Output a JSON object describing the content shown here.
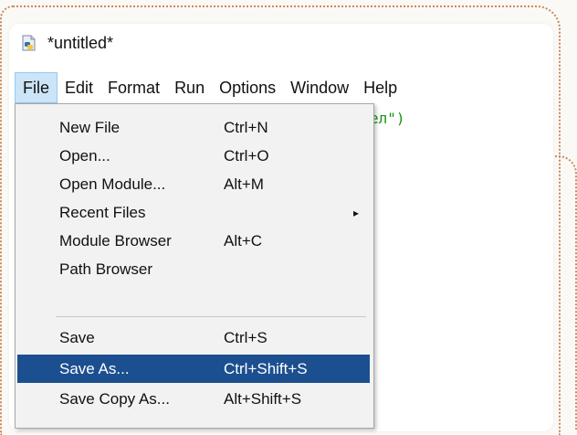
{
  "window": {
    "title": "*untitled*"
  },
  "menubar": {
    "items": [
      "File",
      "Edit",
      "Format",
      "Run",
      "Options",
      "Window",
      "Help"
    ]
  },
  "editor": {
    "visible_code_fragment": "ел\")"
  },
  "file_menu": {
    "items": [
      {
        "label": "New File",
        "shortcut": "Ctrl+N"
      },
      {
        "label": "Open...",
        "shortcut": "Ctrl+O"
      },
      {
        "label": "Open Module...",
        "shortcut": "Alt+M"
      },
      {
        "label": "Recent Files",
        "shortcut": "",
        "submenu_arrow": "▸"
      },
      {
        "label": "Module Browser",
        "shortcut": "Alt+C"
      },
      {
        "label": "Path Browser",
        "shortcut": ""
      },
      {
        "label": "Save",
        "shortcut": "Ctrl+S"
      },
      {
        "label": "Save As...",
        "shortcut": "Ctrl+Shift+S"
      },
      {
        "label": "Save Copy As...",
        "shortcut": "Alt+Shift+S"
      }
    ],
    "highlighted_item": "Save As..."
  },
  "colors": {
    "highlight_bg": "#1c4f8f",
    "active_menu_bg": "#cce4f7",
    "frame_dots": "#c98a5c"
  },
  "icons": {
    "title_icon": "python-file-icon",
    "submenu_indicator": "submenu-arrow-icon"
  }
}
